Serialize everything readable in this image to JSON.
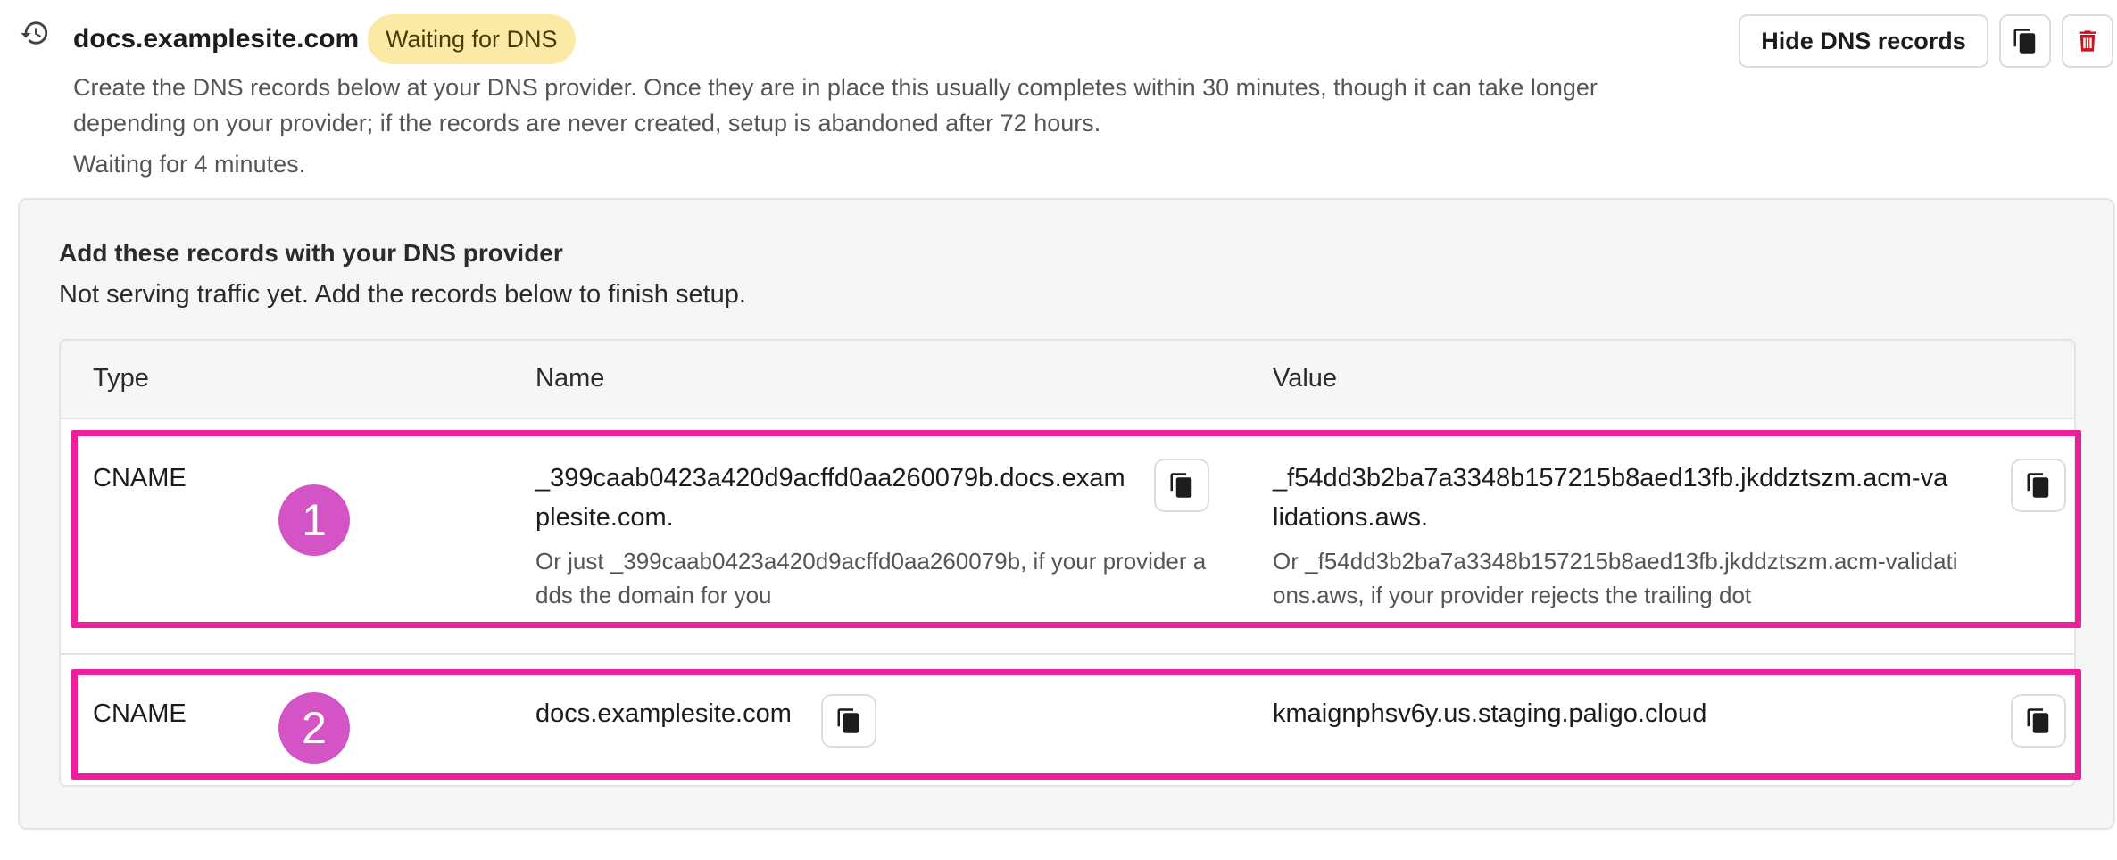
{
  "header": {
    "domain": "docs.examplesite.com",
    "status_badge": "Waiting for DNS",
    "description": "Create the DNS records below at your DNS provider. Once they are in place this usually completes within 30 minutes, though it can take longer depending on your provider; if the records are never created, setup is abandoned after 72 hours.",
    "waiting_text": "Waiting for 4 minutes.",
    "hide_button_label": "Hide DNS records",
    "icons": {
      "history": "history-icon",
      "copy": "copy-icon",
      "delete": "trash-icon"
    },
    "colors": {
      "badge_bg": "#fbeaa6",
      "delete": "#c9141c"
    }
  },
  "panel": {
    "title": "Add these records with your DNS provider",
    "subtitle": "Not serving traffic yet. Add the records below to finish setup."
  },
  "table": {
    "columns": [
      "Type",
      "Name",
      "Value"
    ],
    "rows": [
      {
        "marker": "1",
        "type": "CNAME",
        "name": "_399caab0423a420d9acffd0aa260079b.docs.examplesite.com.",
        "name_note": "Or just _399caab0423a420d9acffd0aa260079b, if your provider adds the domain for you",
        "value": "_f54dd3b2ba7a3348b157215b8aed13fb.jkddztszm.acm-validations.aws.",
        "value_note": "Or _f54dd3b2ba7a3348b157215b8aed13fb.jkddztszm.acm-validations.aws, if your provider rejects the trailing dot"
      },
      {
        "marker": "2",
        "type": "CNAME",
        "name": "docs.examplesite.com",
        "value": "kmaignphsv6y.us.staging.paligo.cloud"
      }
    ]
  },
  "annotation_colors": {
    "highlight": "#ee1f9a",
    "marker": "#d454c6"
  }
}
